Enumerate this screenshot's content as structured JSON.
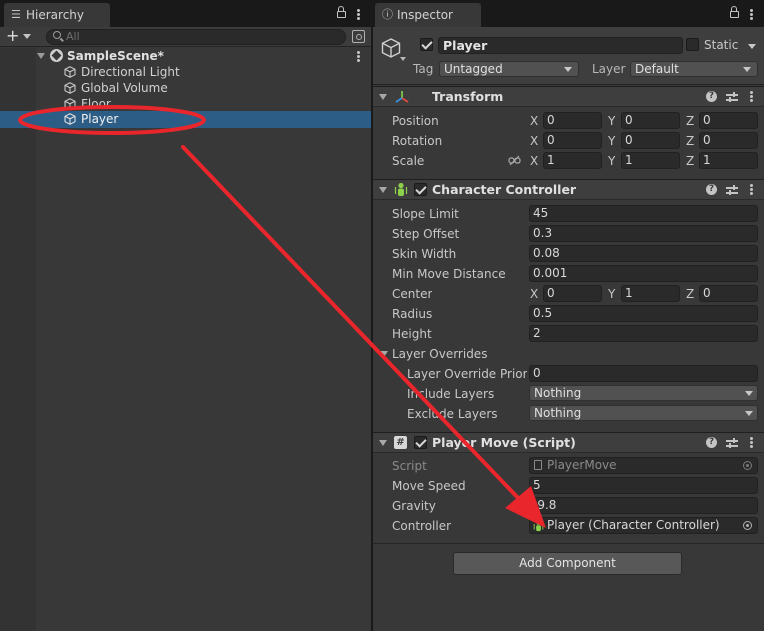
{
  "hierarchy": {
    "tab_label": "Hierarchy",
    "tab_icon": "list-icon",
    "search_placeholder": "All",
    "add_label": "+",
    "scene_name": "SampleScene*",
    "items": [
      {
        "label": "Directional Light",
        "selected": false
      },
      {
        "label": "Global Volume",
        "selected": false
      },
      {
        "label": "Floor",
        "selected": false
      },
      {
        "label": "Player",
        "selected": true
      }
    ]
  },
  "inspector": {
    "tab_label": "Inspector",
    "tab_icon": "info-icon",
    "object": {
      "name": "Player",
      "active": true,
      "static_label": "Static",
      "static": false,
      "tag_label": "Tag",
      "tag_value": "Untagged",
      "layer_label": "Layer",
      "layer_value": "Default"
    },
    "transform": {
      "title": "Transform",
      "position": {
        "label": "Position",
        "x": "0",
        "y": "0",
        "z": "0"
      },
      "rotation": {
        "label": "Rotation",
        "x": "0",
        "y": "0",
        "z": "0"
      },
      "scale": {
        "label": "Scale",
        "x": "1",
        "y": "1",
        "z": "1"
      }
    },
    "character_controller": {
      "title": "Character Controller",
      "enabled": true,
      "slope_limit": {
        "label": "Slope Limit",
        "value": "45"
      },
      "step_offset": {
        "label": "Step Offset",
        "value": "0.3"
      },
      "skin_width": {
        "label": "Skin Width",
        "value": "0.08"
      },
      "min_move_distance": {
        "label": "Min Move Distance",
        "value": "0.001"
      },
      "center": {
        "label": "Center",
        "x": "0",
        "y": "1",
        "z": "0"
      },
      "radius": {
        "label": "Radius",
        "value": "0.5"
      },
      "height": {
        "label": "Height",
        "value": "2"
      },
      "layer_overrides": {
        "label": "Layer Overrides",
        "priority": {
          "label": "Layer Override Priorit",
          "value": "0"
        },
        "include": {
          "label": "Include Layers",
          "value": "Nothing"
        },
        "exclude": {
          "label": "Exclude Layers",
          "value": "Nothing"
        }
      }
    },
    "player_move": {
      "title": "Player Move (Script)",
      "enabled": true,
      "script": {
        "label": "Script",
        "value": "PlayerMove"
      },
      "move_speed": {
        "label": "Move Speed",
        "value": "5"
      },
      "gravity": {
        "label": "Gravity",
        "value": "-9.8"
      },
      "controller": {
        "label": "Controller",
        "value": "Player (Character Controller)"
      }
    },
    "add_component_label": "Add Component"
  },
  "axes": {
    "x": "X",
    "y": "Y",
    "z": "Z"
  },
  "annotation": {
    "color": "#e8262b"
  }
}
